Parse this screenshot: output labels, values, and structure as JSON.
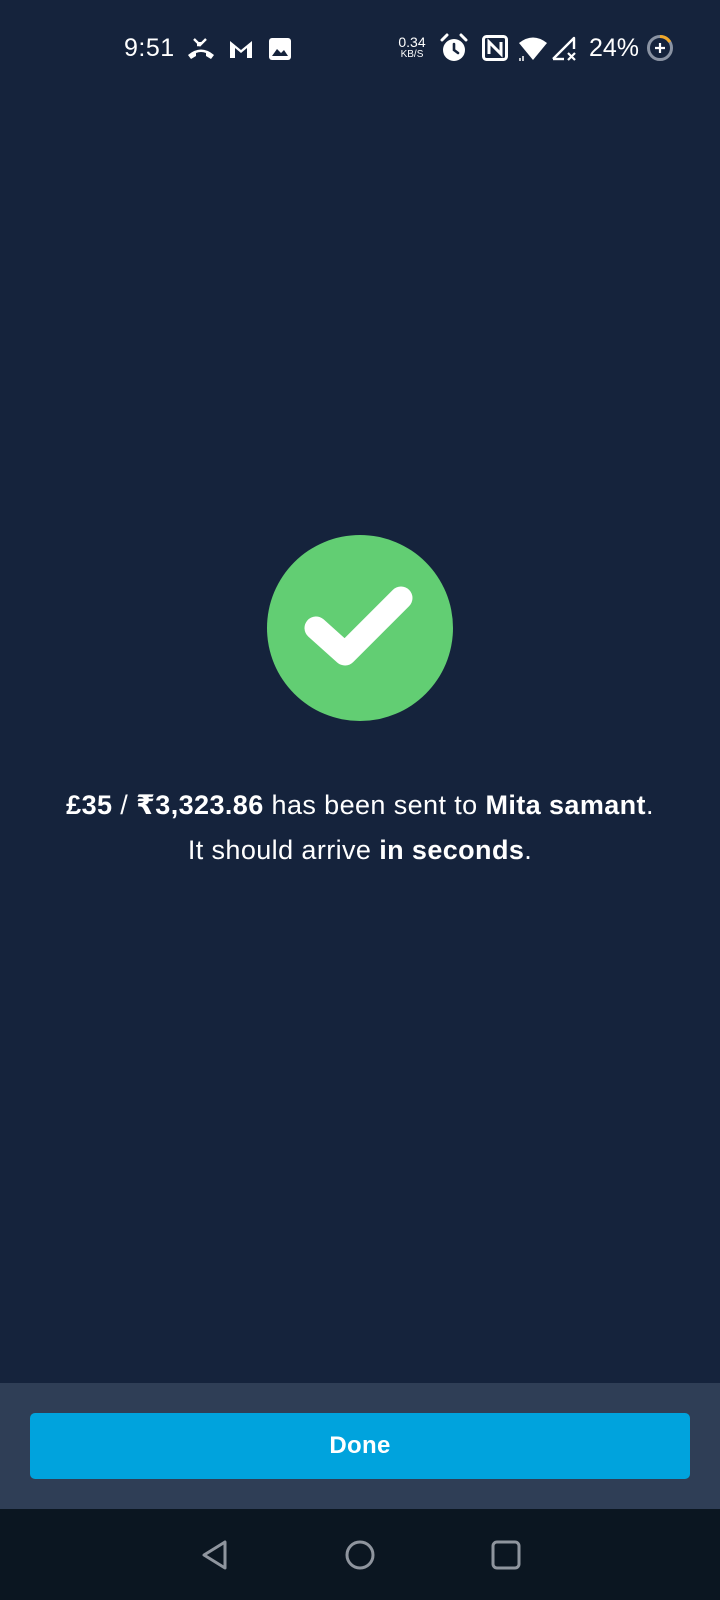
{
  "status_bar": {
    "time": "9:51",
    "net_speed_value": "0.34",
    "net_speed_unit": "KB/S",
    "battery_percent": "24%",
    "icons": [
      "missed-call-icon",
      "gmail-icon",
      "gallery-icon",
      "alarm-icon",
      "nfc-icon",
      "wifi-icon",
      "no-signal-icon",
      "battery-icon"
    ]
  },
  "success": {
    "icon": "checkmark-icon",
    "amount_gbp": "£35",
    "separator": " / ",
    "amount_inr": "₹3,323.86",
    "sent_text": " has been sent to ",
    "recipient": "Mita samant",
    "arrive_text": ". It should arrive ",
    "arrival_time": "in seconds",
    "end_text": "."
  },
  "actions": {
    "done_label": "Done"
  },
  "nav": {
    "back": "back-icon",
    "home": "home-icon",
    "recents": "recents-icon"
  },
  "colors": {
    "background": "#15233c",
    "success_green": "#62ce73",
    "button_blue": "#00a3dd",
    "action_area": "#2f3e56",
    "nav_bar": "#0b1621"
  }
}
